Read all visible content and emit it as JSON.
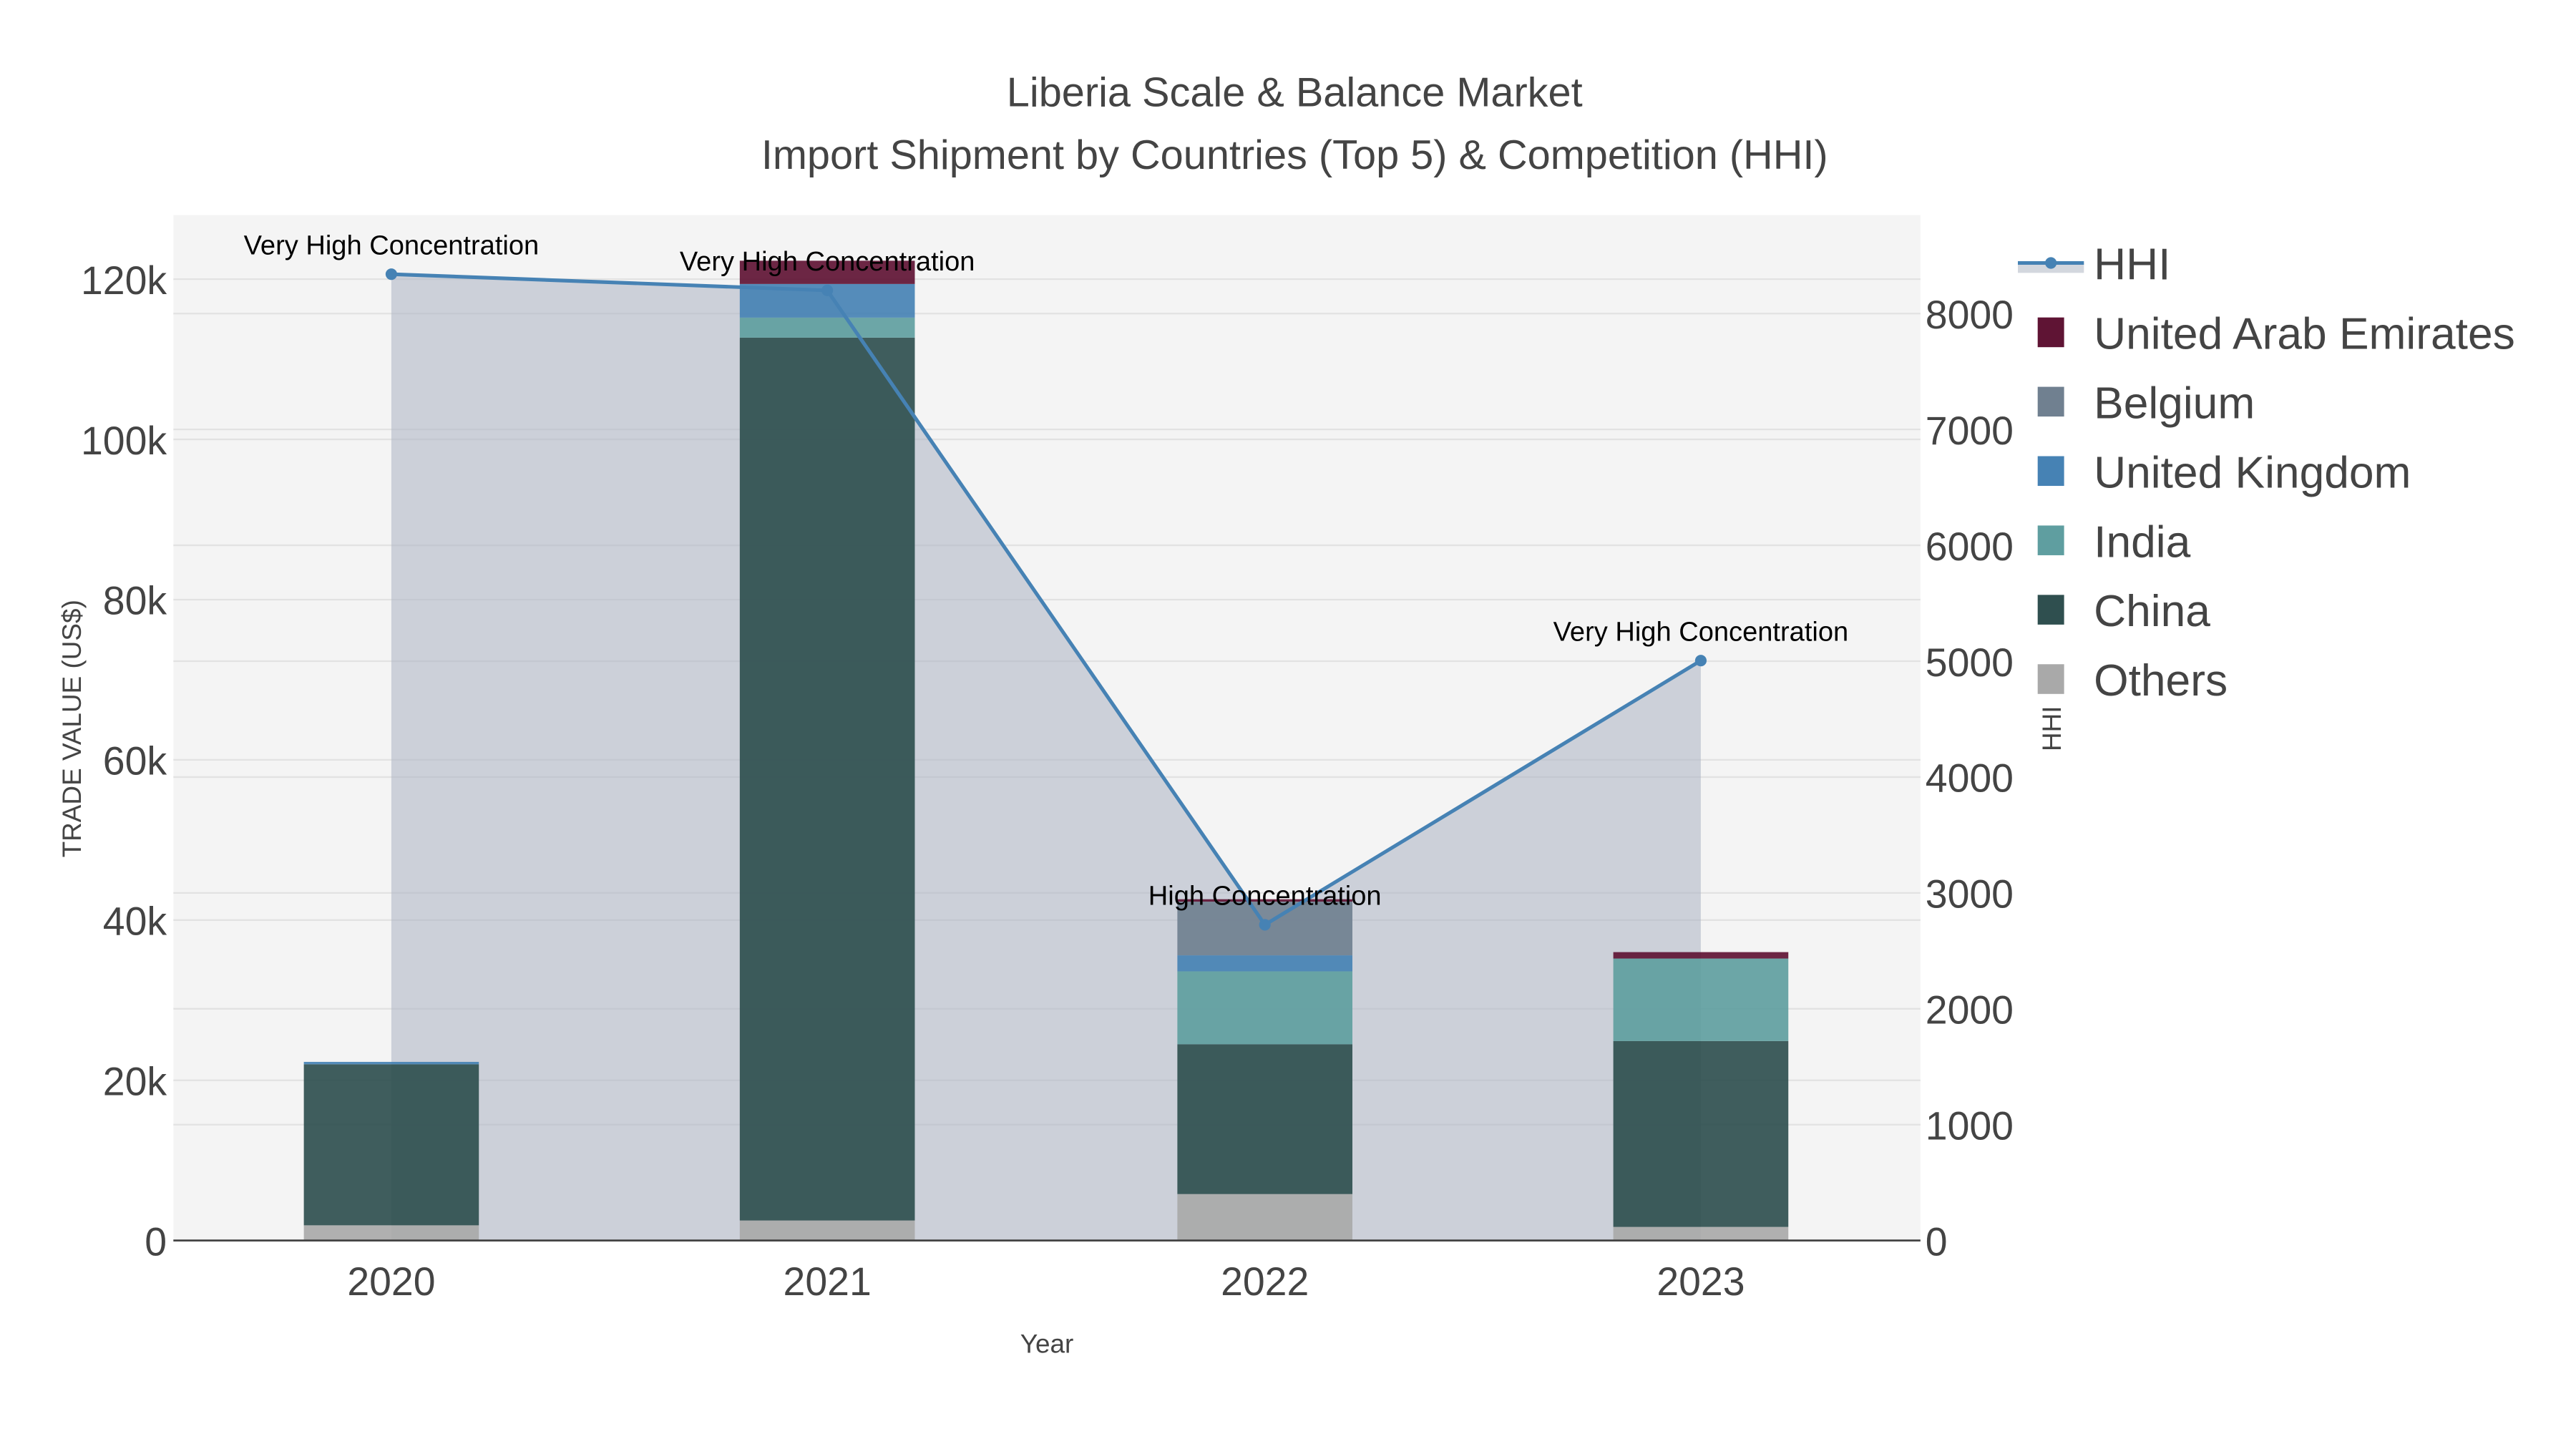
{
  "chart_data": {
    "type": "bar",
    "title": "Liberia Scale & Balance Market",
    "subtitle": "Import Shipment by Countries (Top 5) & Competition (HHI)",
    "xlabel": "Year",
    "ylabel": "TRADE VALUE (US$)",
    "y2label": "HHI",
    "categories": [
      "2020",
      "2021",
      "2022",
      "2023"
    ],
    "ylim": [
      0,
      128000
    ],
    "y2lim": [
      0,
      8850
    ],
    "yticks": [
      0,
      20000,
      40000,
      60000,
      80000,
      100000,
      120000
    ],
    "ytick_labels": [
      "0",
      "20k",
      "40k",
      "60k",
      "80k",
      "100k",
      "120k"
    ],
    "y2ticks": [
      0,
      1000,
      2000,
      3000,
      4000,
      5000,
      6000,
      7000,
      8000
    ],
    "y2tick_labels": [
      "0",
      "1000",
      "2000",
      "3000",
      "4000",
      "5000",
      "6000",
      "7000",
      "8000"
    ],
    "barmode": "stack",
    "series": [
      {
        "name": "Others",
        "color": "#a9a9a9",
        "values": [
          1900,
          2500,
          5800,
          1700
        ]
      },
      {
        "name": "China",
        "color": "#2f4f4f",
        "values": [
          20100,
          110200,
          18700,
          23200
        ]
      },
      {
        "name": "India",
        "color": "#5f9ea0",
        "values": [
          0,
          2500,
          9100,
          10300
        ]
      },
      {
        "name": "United Kingdom",
        "color": "#4682b4",
        "values": [
          300,
          4200,
          2000,
          0
        ]
      },
      {
        "name": "Belgium",
        "color": "#708090",
        "values": [
          0,
          0,
          6700,
          0
        ]
      },
      {
        "name": "United Arab Emirates",
        "color": "#5f1434",
        "values": [
          0,
          2900,
          300,
          800
        ]
      }
    ],
    "hhi": {
      "name": "HHI",
      "color": "#4682b4",
      "values": [
        8340,
        8200,
        2725,
        5005
      ],
      "annotations": [
        "Very High Concentration",
        "Very High Concentration",
        "High Concentration",
        "Very High Concentration"
      ]
    },
    "legend": [
      "HHI",
      "United Arab Emirates",
      "Belgium",
      "United Kingdom",
      "India",
      "China",
      "Others"
    ],
    "legend_placement": "right",
    "grid": true
  }
}
